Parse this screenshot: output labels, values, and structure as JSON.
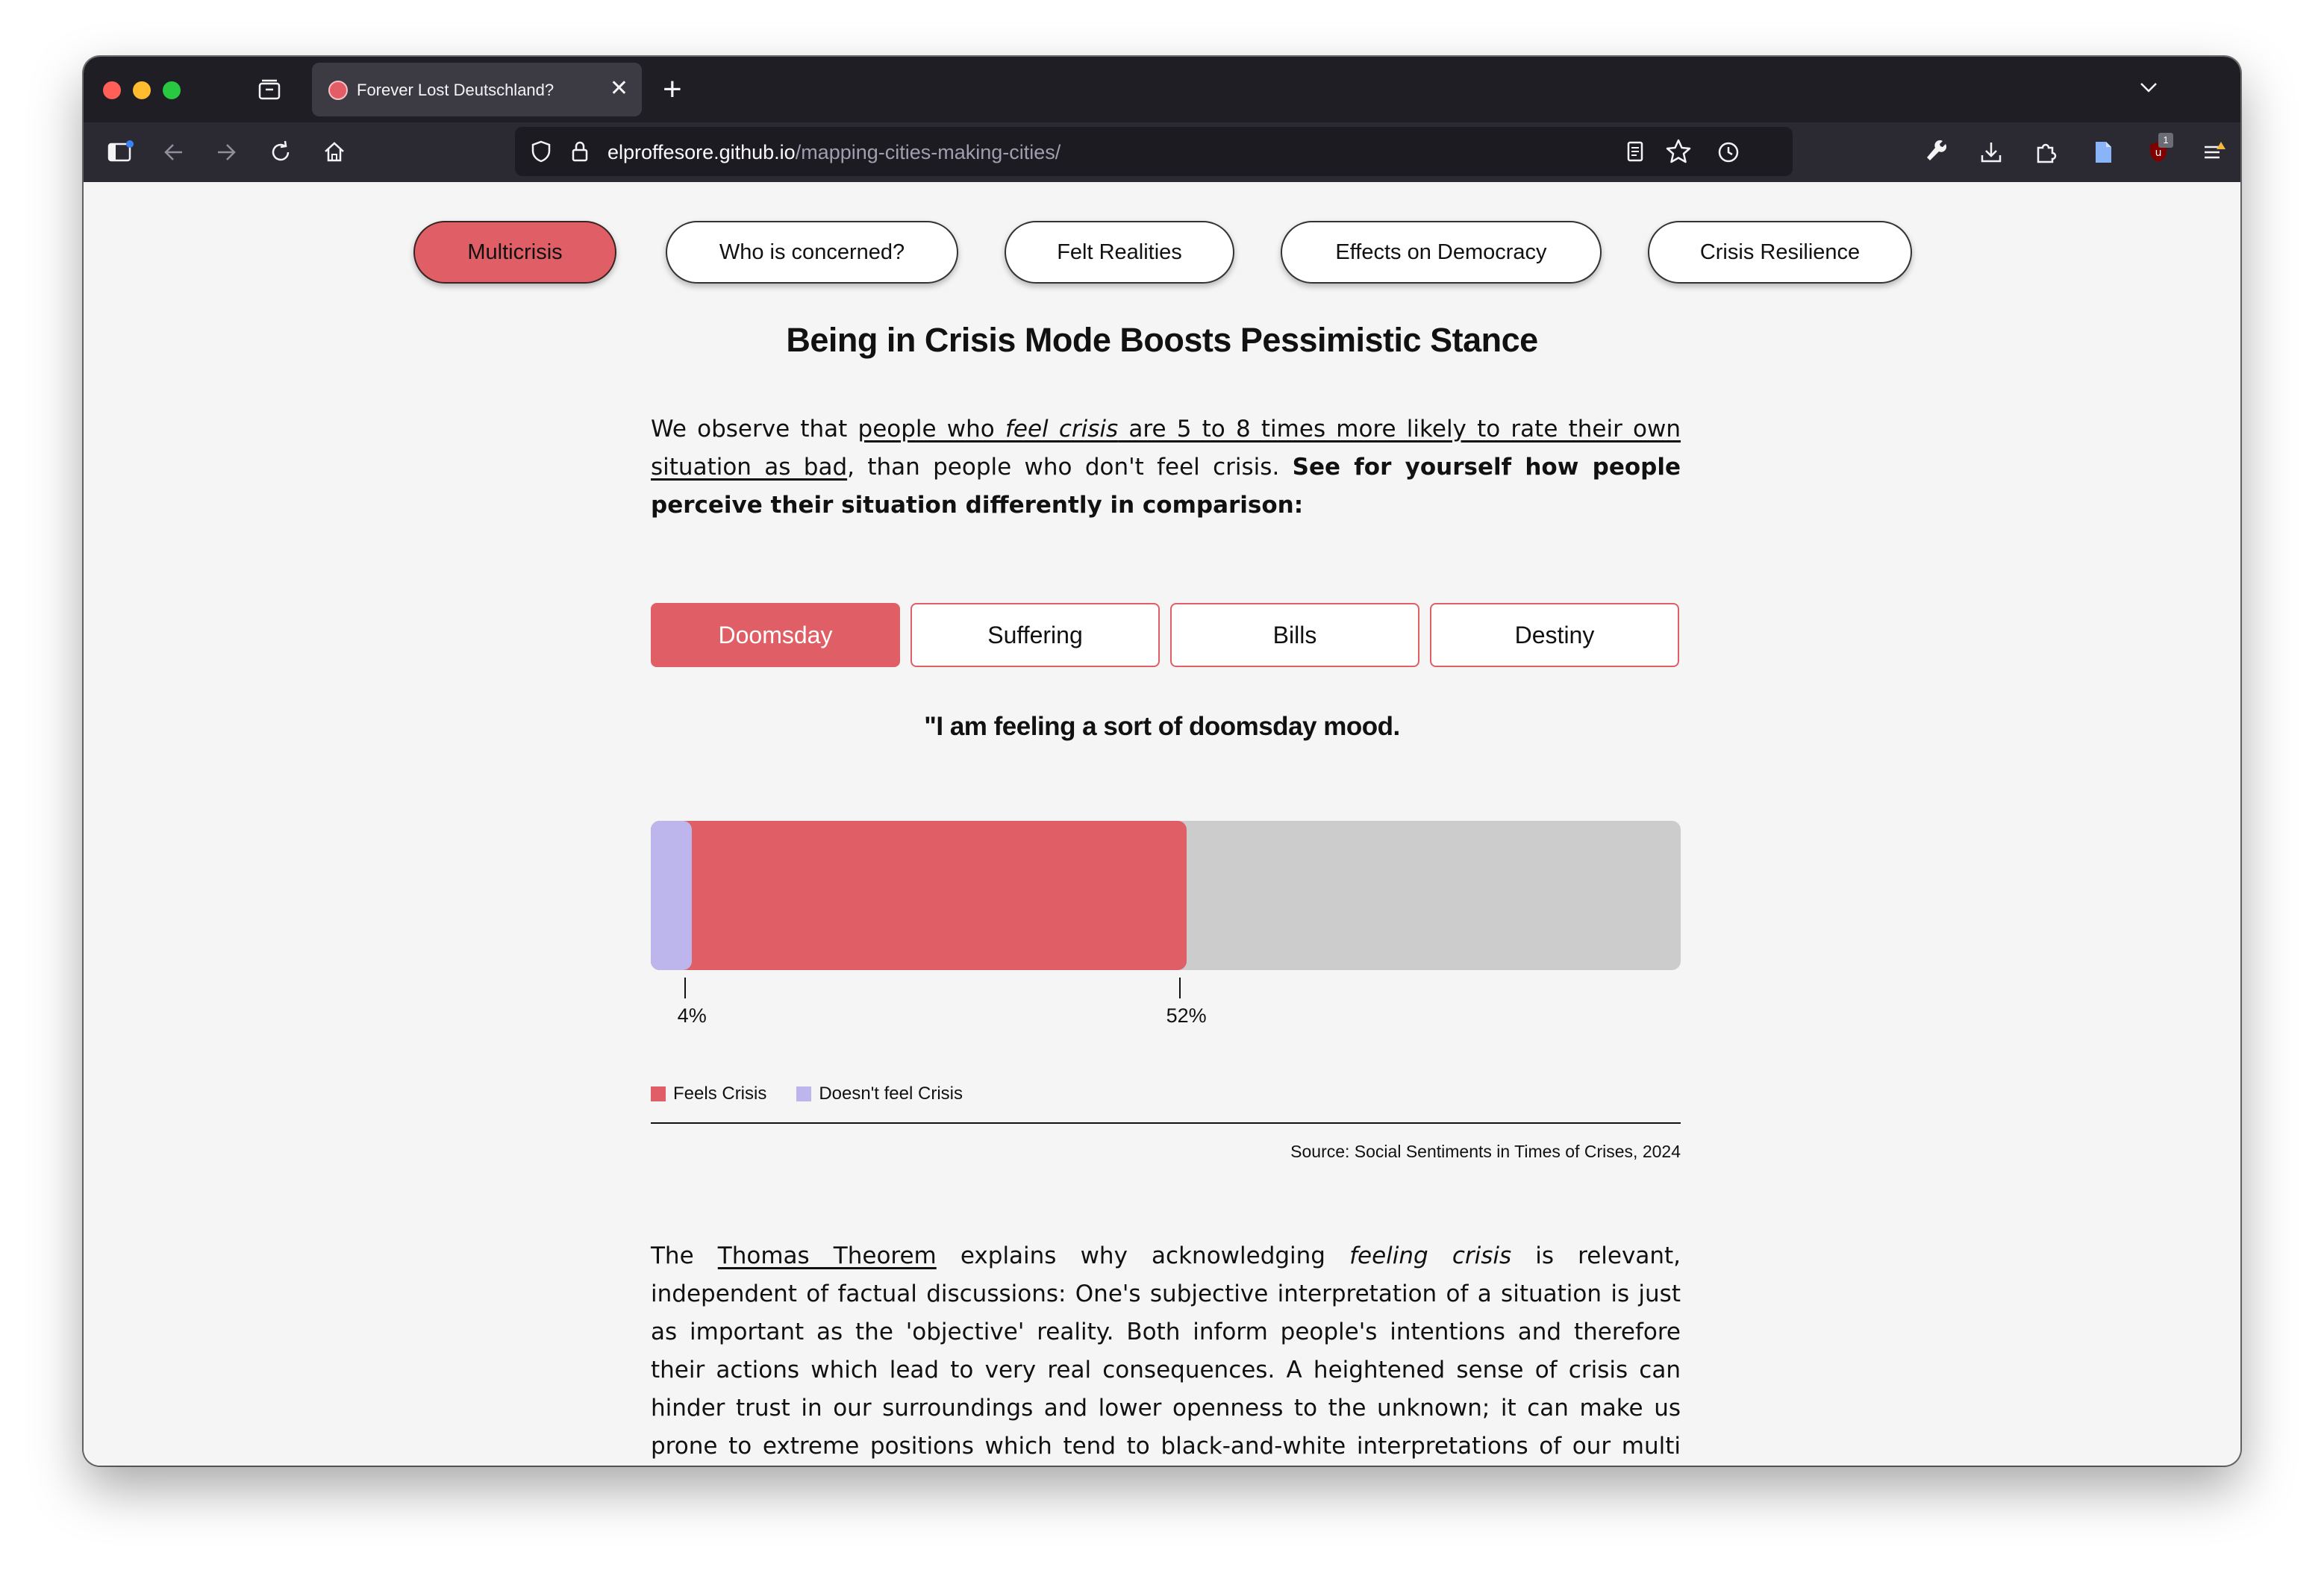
{
  "browser": {
    "tab_title": "Forever Lost Deutschland?",
    "url_domain": "elproffesore.github.io",
    "url_path": "/mapping-cities-making-cities/",
    "extension_badge": "1"
  },
  "nav": {
    "items": [
      "Multicrisis",
      "Who is concerned?",
      "Felt Realities",
      "Effects on Democracy",
      "Crisis Resilience"
    ],
    "active": "Multicrisis"
  },
  "heading": "Being in Crisis Mode Boosts Pessimistic Stance",
  "intro": {
    "t1": "We observe that ",
    "u1": "people who ",
    "u_em": "feel crisis",
    "u2": " are 5 to 8 times more likely to rate their own situation as bad",
    "t2": ", than people who don't feel crisis. ",
    "bold": "See for yourself how people perceive their situation differently in comparison:"
  },
  "segments": {
    "items": [
      "Doomsday",
      "Suffering",
      "Bills",
      "Destiny"
    ],
    "active": "Doomsday"
  },
  "chart_data": {
    "type": "bar",
    "title": "\"I am feeling a sort of doomsday mood.",
    "series": [
      {
        "name": "Feels Crisis",
        "value": 52,
        "label": "52%",
        "color": "#e05f66"
      },
      {
        "name": "Doesn't feel Crisis",
        "value": 4,
        "label": "4%",
        "color": "#bcb6ec"
      }
    ],
    "xlim": [
      0,
      100
    ],
    "track_color": "#cccccc"
  },
  "source": "Source: Social Sentiments in Times of Crises, 2024",
  "outro": {
    "t1": "The ",
    "link": "Thomas Theorem",
    "t2": " explains why acknowledging ",
    "em": "feeling crisis",
    "t3": " is relevant, independent of factual discussions: One's subjective interpretation of a situation is just as important as the 'objective' reality. Both inform people's intentions and therefore their actions which lead to very real consequences. A heightened sense of crisis can hinder trust in our surroundings and lower openness to the unknown; it can make us prone to extreme positions which tend to black-and-white interpretations of our multi faceted and ever changing reality."
  }
}
